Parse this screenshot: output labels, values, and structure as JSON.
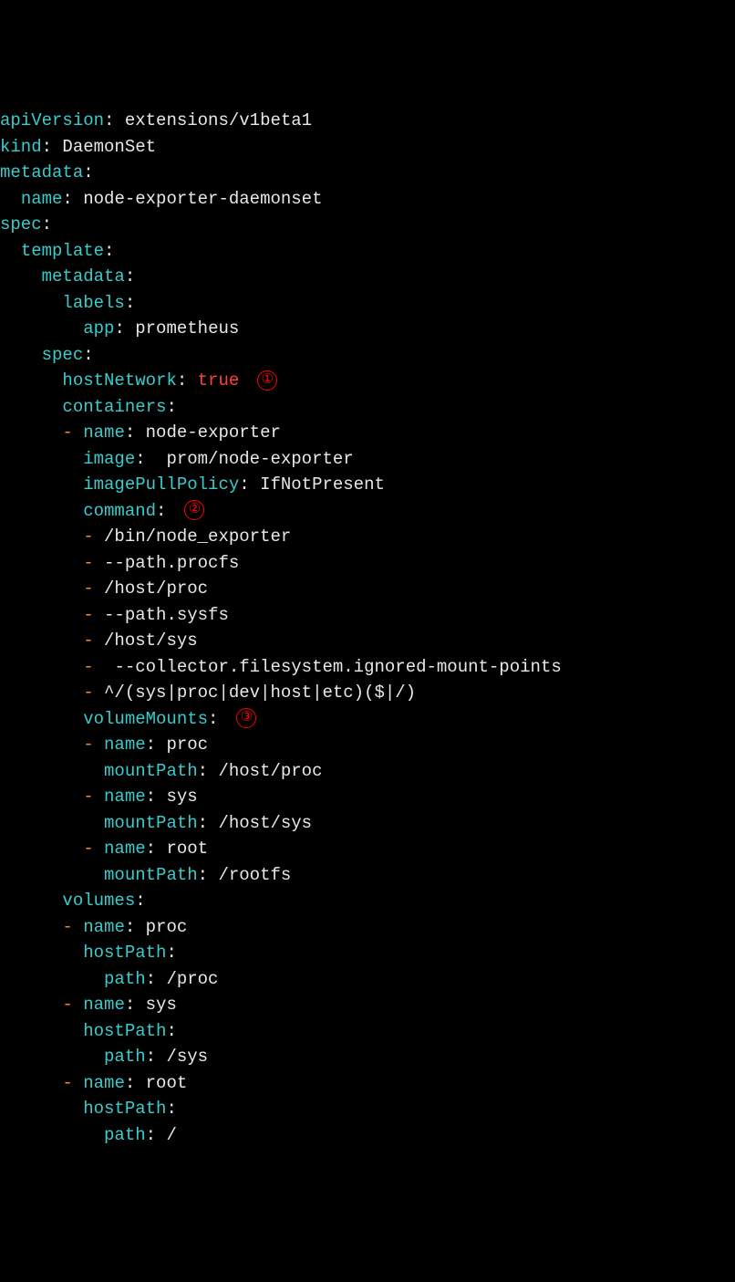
{
  "yaml": {
    "lines": [
      {
        "indent": "",
        "key": "apiVersion",
        "sep": ": ",
        "value": "extensions/v1beta1"
      },
      {
        "indent": "",
        "key": "kind",
        "sep": ": ",
        "value": "DaemonSet"
      },
      {
        "indent": "",
        "key": "metadata",
        "sep": ":",
        "value": ""
      },
      {
        "indent": "  ",
        "key": "name",
        "sep": ": ",
        "value": "node-exporter-daemonset"
      },
      {
        "indent": "",
        "key": "spec",
        "sep": ":",
        "value": ""
      },
      {
        "indent": "  ",
        "key": "template",
        "sep": ":",
        "value": ""
      },
      {
        "indent": "    ",
        "key": "metadata",
        "sep": ":",
        "value": ""
      },
      {
        "indent": "      ",
        "key": "labels",
        "sep": ":",
        "value": ""
      },
      {
        "indent": "        ",
        "key": "app",
        "sep": ": ",
        "value": "prometheus"
      },
      {
        "indent": "    ",
        "key": "spec",
        "sep": ":",
        "value": ""
      },
      {
        "indent": "      ",
        "key": "hostNetwork",
        "sep": ": ",
        "boolValue": "true",
        "annotation": "①"
      },
      {
        "indent": "      ",
        "key": "containers",
        "sep": ":",
        "value": ""
      },
      {
        "indent": "      ",
        "dash": "- ",
        "key": "name",
        "sep": ": ",
        "value": "node-exporter"
      },
      {
        "indent": "        ",
        "key": "image",
        "sep": ":  ",
        "value": "prom/node-exporter"
      },
      {
        "indent": "        ",
        "key": "imagePullPolicy",
        "sep": ": ",
        "value": "IfNotPresent"
      },
      {
        "indent": "        ",
        "key": "command",
        "sep": ":",
        "value": "",
        "annotation": "②"
      },
      {
        "indent": "        ",
        "dash": "- ",
        "value": "/bin/node_exporter"
      },
      {
        "indent": "        ",
        "dash": "- ",
        "value": "--path.procfs"
      },
      {
        "indent": "        ",
        "dash": "- ",
        "value": "/host/proc"
      },
      {
        "indent": "        ",
        "dash": "- ",
        "value": "--path.sysfs"
      },
      {
        "indent": "        ",
        "dash": "- ",
        "value": "/host/sys"
      },
      {
        "indent": "        ",
        "dash": "-  ",
        "value": "--collector.filesystem.ignored-mount-points"
      },
      {
        "indent": "        ",
        "dash": "- ",
        "value": "^/(sys|proc|dev|host|etc)($|/)"
      },
      {
        "indent": "        ",
        "key": "volumeMounts",
        "sep": ":",
        "value": "",
        "annotation": "③"
      },
      {
        "indent": "        ",
        "dash": "- ",
        "key": "name",
        "sep": ": ",
        "value": "proc"
      },
      {
        "indent": "          ",
        "key": "mountPath",
        "sep": ": ",
        "value": "/host/proc"
      },
      {
        "indent": "        ",
        "dash": "- ",
        "key": "name",
        "sep": ": ",
        "value": "sys"
      },
      {
        "indent": "          ",
        "key": "mountPath",
        "sep": ": ",
        "value": "/host/sys"
      },
      {
        "indent": "        ",
        "dash": "- ",
        "key": "name",
        "sep": ": ",
        "value": "root"
      },
      {
        "indent": "          ",
        "key": "mountPath",
        "sep": ": ",
        "value": "/rootfs"
      },
      {
        "indent": "      ",
        "key": "volumes",
        "sep": ":",
        "value": ""
      },
      {
        "indent": "      ",
        "dash": "- ",
        "key": "name",
        "sep": ": ",
        "value": "proc"
      },
      {
        "indent": "        ",
        "key": "hostPath",
        "sep": ":",
        "value": ""
      },
      {
        "indent": "          ",
        "key": "path",
        "sep": ": ",
        "value": "/proc"
      },
      {
        "indent": "      ",
        "dash": "- ",
        "key": "name",
        "sep": ": ",
        "value": "sys"
      },
      {
        "indent": "        ",
        "key": "hostPath",
        "sep": ":",
        "value": ""
      },
      {
        "indent": "          ",
        "key": "path",
        "sep": ": ",
        "value": "/sys"
      },
      {
        "indent": "      ",
        "dash": "- ",
        "key": "name",
        "sep": ": ",
        "value": "root"
      },
      {
        "indent": "        ",
        "key": "hostPath",
        "sep": ":",
        "value": ""
      },
      {
        "indent": "          ",
        "key": "path",
        "sep": ": ",
        "value": "/"
      }
    ]
  },
  "annotations": {
    "a1": "①",
    "a2": "②",
    "a3": "③"
  }
}
